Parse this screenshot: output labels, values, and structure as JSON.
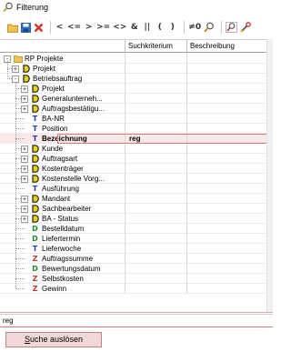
{
  "window": {
    "title": "Filterung"
  },
  "toolbar": {
    "buttons": [
      {
        "name": "open-folder-icon",
        "kind": "svg-folder"
      },
      {
        "name": "save-icon",
        "kind": "svg-save"
      },
      {
        "name": "delete-icon",
        "kind": "svg-x"
      },
      {
        "name": "sep"
      },
      {
        "name": "less-than-button",
        "text": "<"
      },
      {
        "name": "less-equal-button",
        "text": "<="
      },
      {
        "name": "greater-than-button",
        "text": ">"
      },
      {
        "name": "greater-equal-button",
        "text": ">="
      },
      {
        "name": "not-equal-button",
        "text": "<>"
      },
      {
        "name": "and-button",
        "text": "&"
      },
      {
        "name": "or-button",
        "text": "||"
      },
      {
        "name": "open-paren-button",
        "text": "("
      },
      {
        "name": "close-paren-button",
        "text": ")"
      },
      {
        "name": "sep"
      },
      {
        "name": "not-equal-strike-button",
        "text": "≠0"
      },
      {
        "name": "find-icon",
        "kind": "svg-mag"
      },
      {
        "name": "sep"
      },
      {
        "name": "find-replace-icon",
        "kind": "svg-mag2"
      },
      {
        "name": "tools-icon",
        "kind": "svg-tool"
      }
    ]
  },
  "grid": {
    "headers": [
      "",
      "Suchkriterium",
      "Beschreibung"
    ],
    "rows": [
      {
        "level": 0,
        "exp": "-",
        "icon": "folder",
        "label": "RP Projekte"
      },
      {
        "level": 1,
        "exp": "+",
        "icon": "D",
        "label": "Projekt"
      },
      {
        "level": 1,
        "exp": "-",
        "icon": "D",
        "label": "Betriebsauftrag"
      },
      {
        "level": 2,
        "exp": "+",
        "icon": "D",
        "label": "Projekt"
      },
      {
        "level": 2,
        "exp": "+",
        "icon": "D",
        "label": "Generalunterneh..."
      },
      {
        "level": 2,
        "exp": "+",
        "icon": "D",
        "label": "Auftragsbestätigu..."
      },
      {
        "level": 2,
        "exp": "",
        "icon": "T",
        "label": "BA-NR"
      },
      {
        "level": 2,
        "exp": "",
        "icon": "T",
        "label": "Position"
      },
      {
        "level": 2,
        "exp": "",
        "icon": "T",
        "label": "Bezeichnung",
        "crit": "reg",
        "selected": true
      },
      {
        "level": 2,
        "exp": "+",
        "icon": "D",
        "label": "Kunde"
      },
      {
        "level": 2,
        "exp": "+",
        "icon": "D",
        "label": "Auftragsart"
      },
      {
        "level": 2,
        "exp": "+",
        "icon": "D",
        "label": "Kostenträger"
      },
      {
        "level": 2,
        "exp": "+",
        "icon": "D",
        "label": "Kostenstelle Vorg..."
      },
      {
        "level": 2,
        "exp": "",
        "icon": "T",
        "label": "Ausführung"
      },
      {
        "level": 2,
        "exp": "+",
        "icon": "D",
        "label": "Mandant"
      },
      {
        "level": 2,
        "exp": "+",
        "icon": "D",
        "label": "Sachbearbeiter"
      },
      {
        "level": 2,
        "exp": "+",
        "icon": "D",
        "label": "BA - Status"
      },
      {
        "level": 2,
        "exp": "",
        "icon": "Dg",
        "label": "Bestelldatum"
      },
      {
        "level": 2,
        "exp": "",
        "icon": "Dg",
        "label": "Liefertermin"
      },
      {
        "level": 2,
        "exp": "",
        "icon": "T",
        "label": "Lieferwoche"
      },
      {
        "level": 2,
        "exp": "",
        "icon": "Z",
        "label": "Auftragssumme"
      },
      {
        "level": 2,
        "exp": "",
        "icon": "Dg",
        "label": "Bewertungsdatum"
      },
      {
        "level": 2,
        "exp": "",
        "icon": "Z",
        "label": "Selbstkosten"
      },
      {
        "level": 2,
        "exp": "",
        "icon": "Z",
        "label": "Gewinn"
      }
    ]
  },
  "filter": {
    "value": "reg"
  },
  "search_button": {
    "accel": "S",
    "rest": "uche auslösen"
  },
  "colors": {
    "D_icon": "#1d1d1d",
    "D_icon_fill": "#e8d21c",
    "T_icon": "#1e3fa8",
    "Dg_icon": "#1f8a2a",
    "Z_icon": "#c0392b",
    "accent": "#d67a7a"
  }
}
